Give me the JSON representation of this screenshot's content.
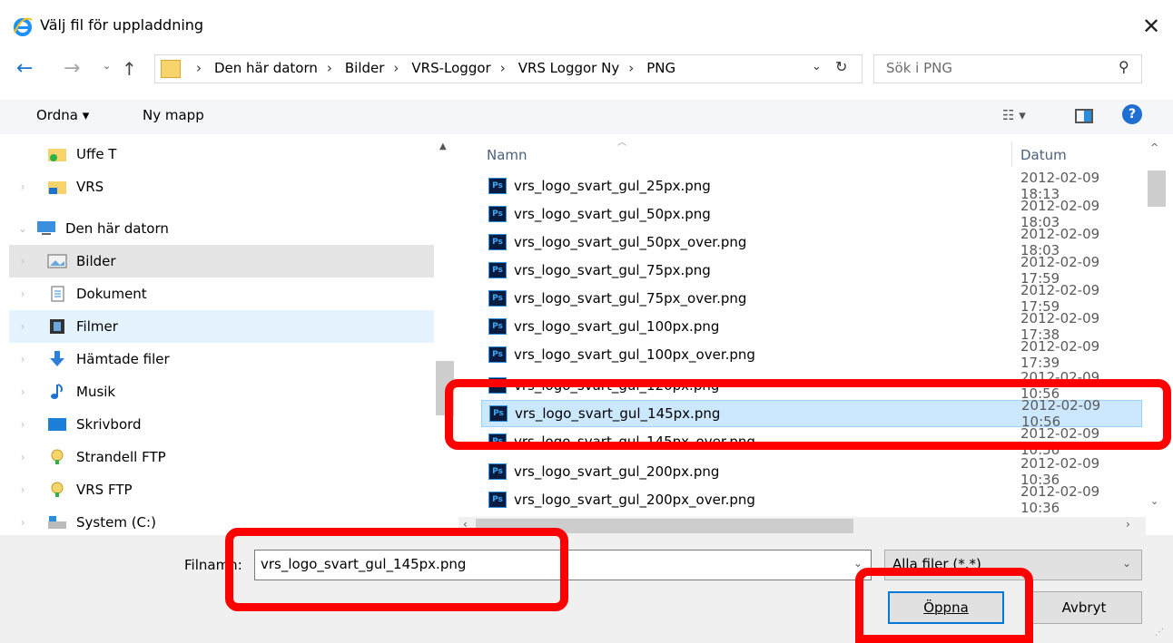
{
  "window": {
    "title": "Välj fil för uppladdning",
    "close_glyph": "✕"
  },
  "address": {
    "crumbs": [
      "Den här datorn",
      "Bilder",
      "VRS-Loggor",
      "VRS Loggor Ny",
      "PNG"
    ],
    "separator": "›",
    "search_placeholder": "Sök i PNG"
  },
  "commands": {
    "organize": "Ordna ▾",
    "new_folder": "Ny mapp"
  },
  "nav_pane": {
    "items": [
      {
        "label": "Uffe T",
        "icon": "user-folder-icon",
        "state": ""
      },
      {
        "label": "VRS",
        "icon": "network-folder-icon",
        "state": ""
      },
      {
        "label": "Den här datorn",
        "icon": "computer-icon",
        "state": ""
      },
      {
        "label": "Bilder",
        "icon": "pictures-icon",
        "state": "selected"
      },
      {
        "label": "Dokument",
        "icon": "documents-icon",
        "state": ""
      },
      {
        "label": "Filmer",
        "icon": "videos-icon",
        "state": "hover"
      },
      {
        "label": "Hämtade filer",
        "icon": "downloads-icon",
        "state": ""
      },
      {
        "label": "Musik",
        "icon": "music-icon",
        "state": ""
      },
      {
        "label": "Skrivbord",
        "icon": "desktop-icon",
        "state": ""
      },
      {
        "label": "Strandell FTP",
        "icon": "ftp-icon",
        "state": ""
      },
      {
        "label": "VRS FTP",
        "icon": "ftp-icon",
        "state": ""
      },
      {
        "label": "System (C:)",
        "icon": "drive-icon",
        "state": ""
      }
    ]
  },
  "file_list": {
    "columns": {
      "name": "Namn",
      "date": "Datum"
    },
    "files": [
      {
        "name": "vrs_logo_svart_gul_25px.png",
        "date": "2012-02-09 18:13"
      },
      {
        "name": "vrs_logo_svart_gul_50px.png",
        "date": "2012-02-09 18:03"
      },
      {
        "name": "vrs_logo_svart_gul_50px_over.png",
        "date": "2012-02-09 18:03"
      },
      {
        "name": "vrs_logo_svart_gul_75px.png",
        "date": "2012-02-09 17:59"
      },
      {
        "name": "vrs_logo_svart_gul_75px_over.png",
        "date": "2012-02-09 17:59"
      },
      {
        "name": "vrs_logo_svart_gul_100px.png",
        "date": "2012-02-09 17:38"
      },
      {
        "name": "vrs_logo_svart_gul_100px_over.png",
        "date": "2012-02-09 17:39"
      },
      {
        "name": "vrs_logo_svart_gul_120px.png",
        "date": "2012-02-09 10:56"
      },
      {
        "name": "vrs_logo_svart_gul_145px.png",
        "date": "2012-02-09 10:56",
        "selected": true
      },
      {
        "name": "vrs_logo_svart_gul_145px_over.png",
        "date": "2012-02-09 10:56"
      },
      {
        "name": "vrs_logo_svart_gul_200px.png",
        "date": "2012-02-09 10:36"
      },
      {
        "name": "vrs_logo_svart_gul_200px_over.png",
        "date": "2012-02-09 10:36"
      }
    ]
  },
  "bottom": {
    "filename_label": "Filnamn:",
    "filename_value": "vrs_logo_svart_gul_145px.png",
    "filter_value": "Alla filer (*.*)",
    "open_label": "Öppna",
    "cancel_label": "Avbryt"
  },
  "colors": {
    "annotation": "#ff0000",
    "selection": "#cce8ff",
    "accent": "#0078d7"
  }
}
